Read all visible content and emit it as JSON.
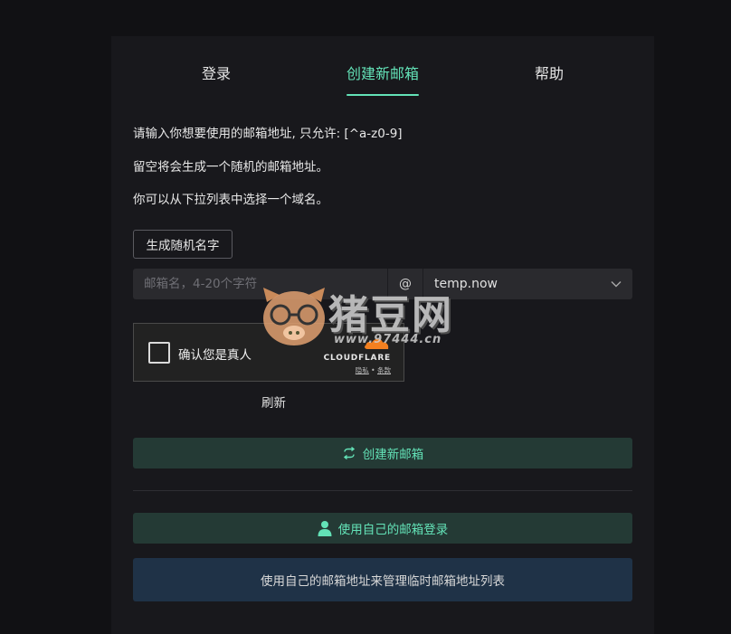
{
  "tabs": [
    {
      "label": "登录"
    },
    {
      "label": "创建新邮箱"
    },
    {
      "label": "帮助"
    }
  ],
  "active_tab": "创建新邮箱",
  "instructions": {
    "line1": "请输入你想要使用的邮箱地址, 只允许: [^a-z0-9]",
    "line2": "留空将会生成一个随机的邮箱地址。",
    "line3": "你可以从下拉列表中选择一个域名。"
  },
  "generate_button": "生成随机名字",
  "address": {
    "placeholder": "邮箱名，4-20个字符",
    "value": "",
    "at_symbol": "@",
    "domain": "temp.now"
  },
  "captcha": {
    "label": "确认您是真人",
    "provider": "CLOUDFLARE",
    "privacy": "隐私",
    "separator": "•",
    "terms": "条款"
  },
  "refresh_label": "刷新",
  "create_button": "创建新邮箱",
  "own_login_button": "使用自己的邮箱登录",
  "manage_button": "使用自己的邮箱地址来管理临时邮箱地址列表",
  "watermark": {
    "brand": "猪豆网",
    "url": "www.97444.cn"
  },
  "colors": {
    "accent": "#63e2b7",
    "background": "#111114",
    "panel": "#18181c",
    "create_bg": "#243a35",
    "manage_bg": "#1f3247"
  },
  "icons": {
    "create": "swap-arrows-icon",
    "login": "user-icon",
    "select": "chevron-down-icon",
    "captcha_cloud": "cloudflare-cloud-icon"
  }
}
